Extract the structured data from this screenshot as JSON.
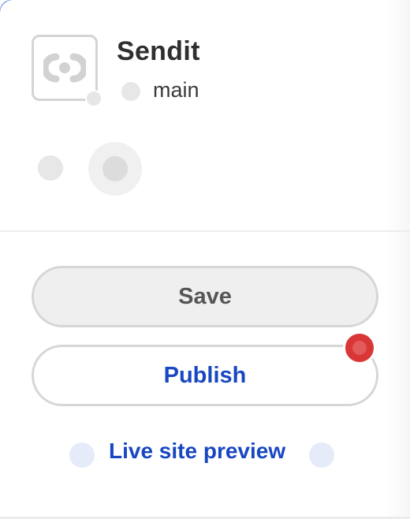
{
  "site": {
    "name": "Sendit",
    "branch": "main"
  },
  "actions": {
    "save_label": "Save",
    "publish_label": "Publish",
    "preview_label": "Live site preview"
  },
  "colors": {
    "accent": "#1847c2",
    "notification": "#d93636",
    "text_dark": "#2f2f2f",
    "button_disabled_bg": "#efefef"
  },
  "icons": {
    "logo": "cloud-logo-icon",
    "logo_badge": "status-badge",
    "branch": "branch-icon",
    "notification": "notification-dot-icon",
    "preview_left": "external-link-icon",
    "preview_right": "chevron-icon"
  }
}
